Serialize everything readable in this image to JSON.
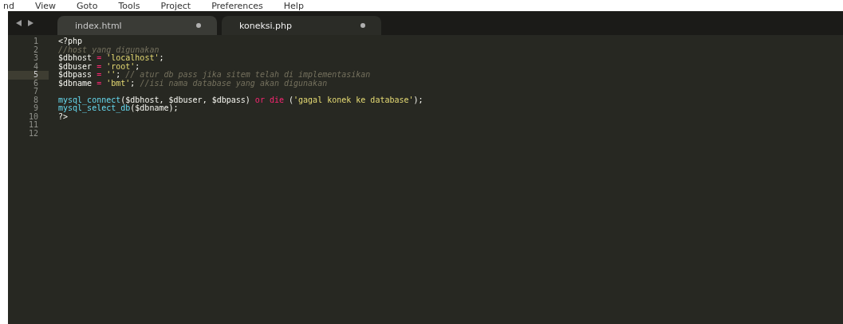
{
  "menu": [
    "nd",
    "View",
    "Goto",
    "Tools",
    "Project",
    "Preferences",
    "Help"
  ],
  "tabs": [
    {
      "label": "index.html",
      "selected": false,
      "dirty": true
    },
    {
      "label": "koneksi.php",
      "selected": true,
      "dirty": true
    }
  ],
  "editor": {
    "lines": [
      {
        "number": "1",
        "selected": false,
        "tokens": [
          {
            "kind": "plain",
            "text": "<?php"
          }
        ]
      },
      {
        "number": "2",
        "selected": false,
        "tokens": [
          {
            "kind": "comment",
            "text": "//host yang digunakan"
          }
        ]
      },
      {
        "number": "3",
        "selected": false,
        "tokens": [
          {
            "kind": "plain",
            "text": "$dbhost "
          },
          {
            "kind": "keyword",
            "text": "="
          },
          {
            "kind": "string",
            "text": " 'localhost'"
          },
          {
            "kind": "plain",
            "text": ";"
          }
        ]
      },
      {
        "number": "4",
        "selected": false,
        "tokens": [
          {
            "kind": "plain",
            "text": "$dbuser "
          },
          {
            "kind": "keyword",
            "text": "="
          },
          {
            "kind": "string",
            "text": " 'root'"
          },
          {
            "kind": "plain",
            "text": ";"
          }
        ]
      },
      {
        "number": "5",
        "selected": true,
        "tokens": [
          {
            "kind": "plain",
            "text": "$dbpass "
          },
          {
            "kind": "keyword",
            "text": "="
          },
          {
            "kind": "string",
            "text": " ''"
          },
          {
            "kind": "plain",
            "text": "; "
          },
          {
            "kind": "comment",
            "text": "// atur db pass jika sitem telah di implementasikan"
          }
        ]
      },
      {
        "number": "6",
        "selected": false,
        "tokens": [
          {
            "kind": "plain",
            "text": "$dbname "
          },
          {
            "kind": "keyword",
            "text": "="
          },
          {
            "kind": "string",
            "text": " 'bmt'"
          },
          {
            "kind": "plain",
            "text": "; "
          },
          {
            "kind": "comment",
            "text": "//isi nama database yang akan digunakan"
          }
        ]
      },
      {
        "number": "7",
        "selected": false
      },
      {
        "number": "8",
        "selected": false,
        "tokens": [
          {
            "kind": "function",
            "text": "mysql_connect"
          },
          {
            "kind": "plain",
            "text": "($dbhost, $dbuser, $dbpass) "
          },
          {
            "kind": "keyword",
            "text": "or die"
          },
          {
            "kind": "plain",
            "text": " ("
          },
          {
            "kind": "string",
            "text": "'gagal konek ke database'"
          },
          {
            "kind": "plain",
            "text": ");"
          }
        ]
      },
      {
        "number": "9",
        "selected": false,
        "tokens": [
          {
            "kind": "function",
            "text": "mysql_select_db"
          },
          {
            "kind": "plain",
            "text": "($dbname);"
          }
        ]
      },
      {
        "number": "10",
        "selected": false,
        "tokens": [
          {
            "kind": "plain",
            "text": "?>"
          }
        ]
      },
      {
        "number": "11",
        "selected": false
      },
      {
        "number": "12",
        "selected": false
      }
    ]
  }
}
